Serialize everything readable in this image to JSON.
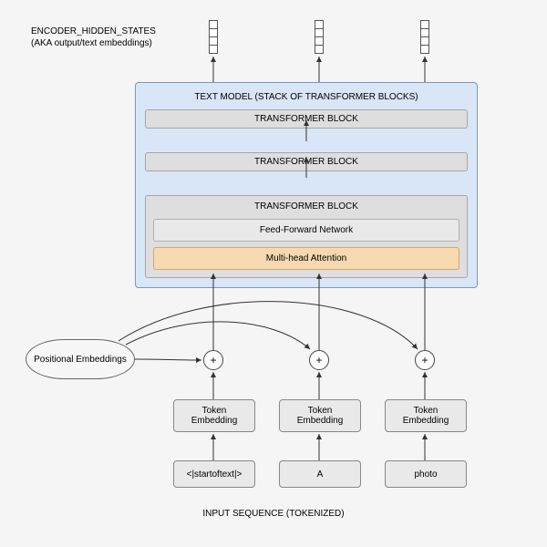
{
  "header": {
    "title": "ENCODER_HIDDEN_STATES",
    "subtitle": "(AKA output/text embeddings)"
  },
  "text_model": {
    "title": "TEXT MODEL (STACK OF TRANSFORMER BLOCKS)",
    "block_top": "TRANSFORMER BLOCK",
    "block_mid": "TRANSFORMER BLOCK",
    "expanded": {
      "title": "TRANSFORMER BLOCK",
      "ffn": "Feed-Forward Network",
      "mha": "Multi-head Attention"
    }
  },
  "positional": "Positional Embeddings",
  "plus": "+",
  "columns": [
    {
      "token_emb": "Token Embedding",
      "token": "<|startoftext|>"
    },
    {
      "token_emb": "Token Embedding",
      "token": "A"
    },
    {
      "token_emb": "Token Embedding",
      "token": "photo"
    }
  ],
  "footer": "INPUT SEQUENCE (TOKENIZED)"
}
